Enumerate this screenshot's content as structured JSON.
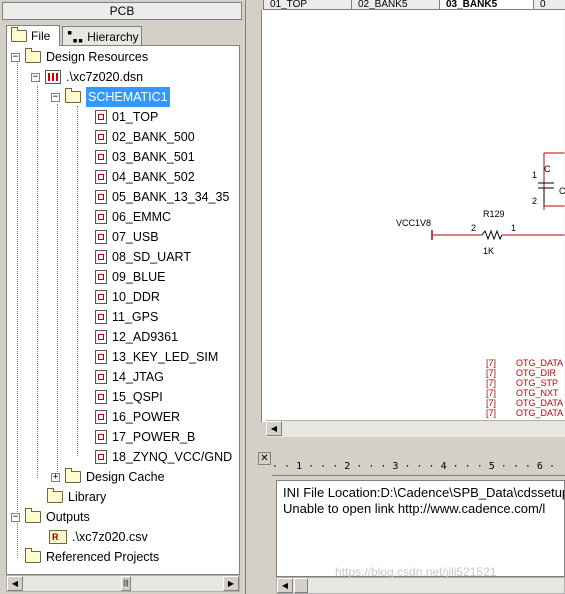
{
  "panel_title": "PCB",
  "tabs": [
    {
      "label": "File",
      "icon": "folder-icon"
    },
    {
      "label": "Hierarchy",
      "icon": "hierarchy-icon"
    }
  ],
  "tree": {
    "design_resources": "Design Resources",
    "dsn_file": ".\\xc7z020.dsn",
    "schematic": "SCHEMATIC1",
    "pages": [
      "01_TOP",
      "02_BANK_500",
      "03_BANK_501",
      "04_BANK_502",
      "05_BANK_13_34_35",
      "06_EMMC",
      "07_USB",
      "08_SD_UART",
      "09_BLUE",
      "10_DDR",
      "11_GPS",
      "12_AD9361",
      "13_KEY_LED_SIM",
      "14_JTAG",
      "15_QSPI",
      "16_POWER",
      "17_POWER_B",
      "18_ZYNQ_VCC/GND"
    ],
    "design_cache": "Design Cache",
    "library": "Library",
    "outputs": "Outputs",
    "csv_file": ".\\xc7z020.csv",
    "referenced_projects": "Referenced Projects"
  },
  "doc_tabs": [
    "01_TOP",
    "02_BANK5",
    "03_BANK5",
    "0"
  ],
  "schematic": {
    "net_label": "VCC1V8",
    "resistor_ref": "R129",
    "resistor_value": "1K",
    "pin_left": "2",
    "pin_right": "1",
    "cap_pin_top": "1",
    "cap_pin_bottom": "2",
    "cap_label_top": "C",
    "cap_label_bottom": "C",
    "signals": [
      {
        "ref": "[7]",
        "name": "OTG_DATA"
      },
      {
        "ref": "[7]",
        "name": "OTG_DIR"
      },
      {
        "ref": "[7]",
        "name": "OTG_STP"
      },
      {
        "ref": "[7]",
        "name": "OTG_NXT"
      },
      {
        "ref": "[7]",
        "name": "OTG_DATA"
      },
      {
        "ref": "[7]",
        "name": "OTG_DATA"
      }
    ]
  },
  "ruler_text": "· · 1 · · · 2 · · · 3 · · · 4 · · · 5 · · · 6 · · · 7 ·",
  "log": [
    "INI File Location:D:\\Cadence\\SPB_Data\\cdssetup\\",
    "Unable to open link http://www.cadence.com/l"
  ],
  "watermark": "https://blog.csdn.net/jili521521",
  "colors": {
    "selection": "#3399ff",
    "wire": "#c00000",
    "folder": "#fffbd0"
  }
}
